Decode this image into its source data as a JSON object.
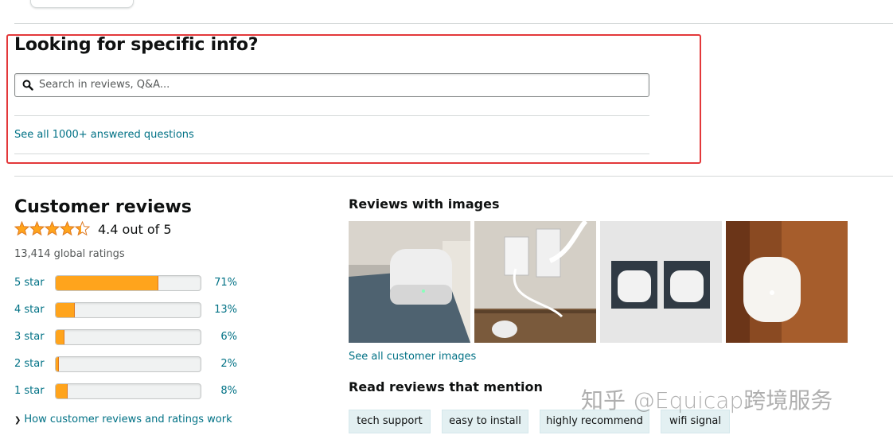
{
  "specific_info": {
    "heading": "Looking for specific info?",
    "search_placeholder": "Search in reviews, Q&A...",
    "see_all_questions": "See all 1000+ answered questions"
  },
  "customer_reviews": {
    "heading": "Customer reviews",
    "average": "4.4 out of 5",
    "star_rating": 4.4,
    "global_ratings": "13,414 global ratings",
    "histogram": [
      {
        "label": "5 star",
        "percent": 71,
        "percent_text": "71%"
      },
      {
        "label": "4 star",
        "percent": 13,
        "percent_text": "13%"
      },
      {
        "label": "3 star",
        "percent": 6,
        "percent_text": "6%"
      },
      {
        "label": "2 star",
        "percent": 2,
        "percent_text": "2%"
      },
      {
        "label": "1 star",
        "percent": 8,
        "percent_text": "8%"
      }
    ],
    "how_it_works": "How customer reviews and ratings work"
  },
  "reviews_with_images": {
    "heading": "Reviews with images",
    "see_all_images": "See all customer images"
  },
  "mention": {
    "heading": "Read reviews that mention",
    "chips": [
      "tech support",
      "easy to install",
      "highly recommend",
      "wifi signal"
    ]
  },
  "watermark": "知乎 @Equicap跨境服务",
  "colors": {
    "link": "#007185",
    "star": "#ffa41c",
    "highlight_border": "#e3383a"
  }
}
